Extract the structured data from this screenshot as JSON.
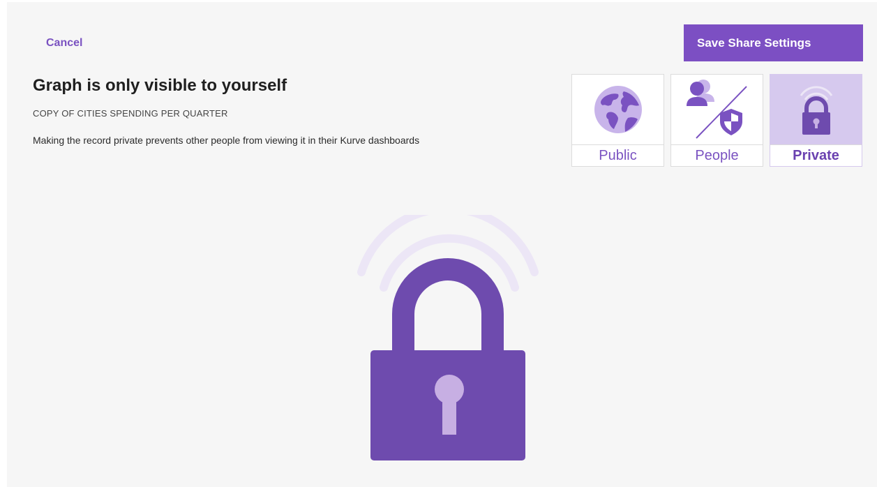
{
  "header": {
    "cancel_label": "Cancel",
    "save_label": "Save Share Settings"
  },
  "info": {
    "title": "Graph is only visible to yourself",
    "record_name": "COPY OF CITIES SPENDING PER QUARTER",
    "description": "Making the record private prevents other people from viewing it in their Kurve dashboards"
  },
  "share_options": [
    {
      "label": "Public",
      "icon": "globe-icon",
      "selected": false
    },
    {
      "label": "People",
      "icon": "people-shield-icon",
      "selected": false
    },
    {
      "label": "Private",
      "icon": "lock-icon",
      "selected": true
    }
  ],
  "colors": {
    "accent": "#7c4fc3",
    "accent_light": "#d6c9ee",
    "lock": "#6e4bae",
    "background": "#f6f6f6"
  }
}
